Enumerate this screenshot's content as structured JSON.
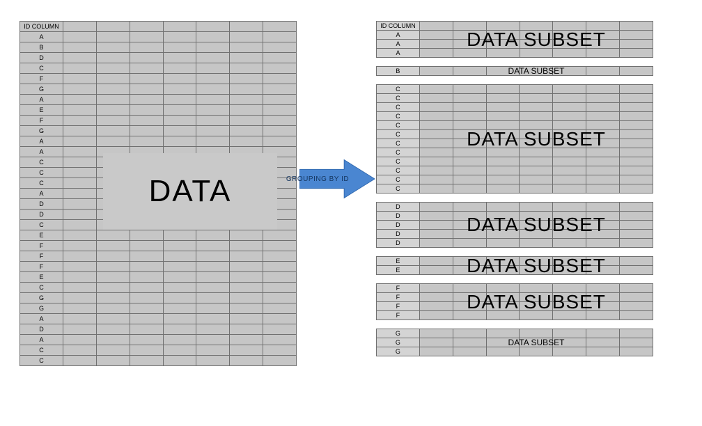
{
  "left": {
    "header": "ID COLUMN",
    "rows": [
      "A",
      "B",
      "D",
      "C",
      "F",
      "G",
      "A",
      "E",
      "F",
      "G",
      "A",
      "A",
      "C",
      "C",
      "C",
      "A",
      "D",
      "D",
      "C",
      "E",
      "F",
      "F",
      "F",
      "E",
      "C",
      "G",
      "G",
      "A",
      "D",
      "A",
      "C",
      "C"
    ],
    "data_columns": 7,
    "big_label": "DATA"
  },
  "arrow_label": "GROUPING BY ID",
  "subsets": [
    {
      "header": "ID COLUMN",
      "ids": [
        "A",
        "A",
        "A"
      ],
      "label_size": "big",
      "label": "DATA SUBSET"
    },
    {
      "header": null,
      "ids": [
        "B"
      ],
      "label_size": "small",
      "label": "DATA SUBSET"
    },
    {
      "header": null,
      "ids": [
        "C",
        "C",
        "C",
        "C",
        "C",
        "C",
        "C",
        "C",
        "C",
        "C",
        "C",
        "C"
      ],
      "label_size": "big",
      "label": "DATA SUBSET"
    },
    {
      "header": null,
      "ids": [
        "D",
        "D",
        "D",
        "D",
        "D"
      ],
      "label_size": "big",
      "label": "DATA SUBSET"
    },
    {
      "header": null,
      "ids": [
        "E",
        "E"
      ],
      "label_size": "big",
      "label": "DATA SUBSET"
    },
    {
      "header": null,
      "ids": [
        "F",
        "F",
        "F",
        "F"
      ],
      "label_size": "big",
      "label": "DATA SUBSET"
    },
    {
      "header": null,
      "ids": [
        "G",
        "G",
        "G"
      ],
      "label_size": "small",
      "label": "DATA SUBSET"
    }
  ],
  "data_columns_right": 7
}
